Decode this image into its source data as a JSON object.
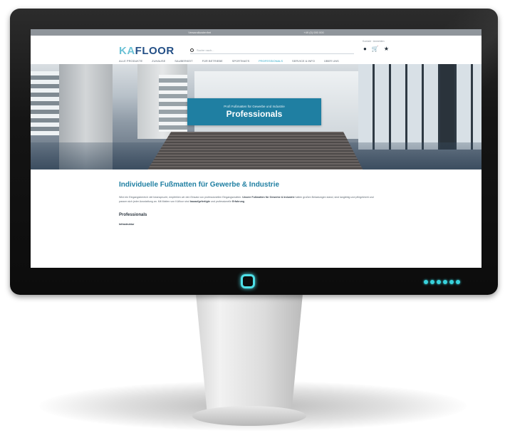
{
  "topbar": {
    "left_text": "Versandkostenfrei",
    "right_text": "+49 (0) 000 000"
  },
  "header": {
    "logo_ka": "KA",
    "logo_floor": "FLOOR",
    "search_placeholder": "Suche nach...",
    "top_links": "Kontakt · Anmelden",
    "icons": {
      "account": "account-icon",
      "cart": "cart-icon",
      "wishlist": "star-icon"
    }
  },
  "nav": {
    "items": [
      "ALLE PRODUKTE",
      "ZUHAUSE",
      "SAUBERKEIT",
      "FÜR BETRIEBE",
      "SPORTMATS",
      "PROFESSIONALS",
      "SERVICE & INFO",
      "ÜBER UNS"
    ],
    "active_index": 5
  },
  "hero": {
    "kicker": "Profi Fußmatten für Gewerbe und Industrie",
    "title": "Professionals"
  },
  "content": {
    "heading": "Individuelle Fußmatten für Gewerbe & Industrie",
    "para_1": "Wird ein Eingangsbereich viel beansprucht, empfehlen wir den Einsatz von professionellen Eingangsmatten.",
    "para_bold_1": "Unsere Fußmatten für Gewerbe & Industrie",
    "para_2": "halten großen Belastungen stand, sind langlebig und pflegeleicht und passen sich jeder Ausstattung an. Mit Matten von KAfloor sind",
    "para_bold_2": "bauaufgefertigte",
    "para_3": "und professionelle",
    "para_bold_3": "Erfahrung",
    "subheading": "Professionals",
    "subsubheading": "Infrastruktur"
  },
  "device": {
    "accent_color": "#38d2dc",
    "brand_color": "#1f7fa2"
  }
}
